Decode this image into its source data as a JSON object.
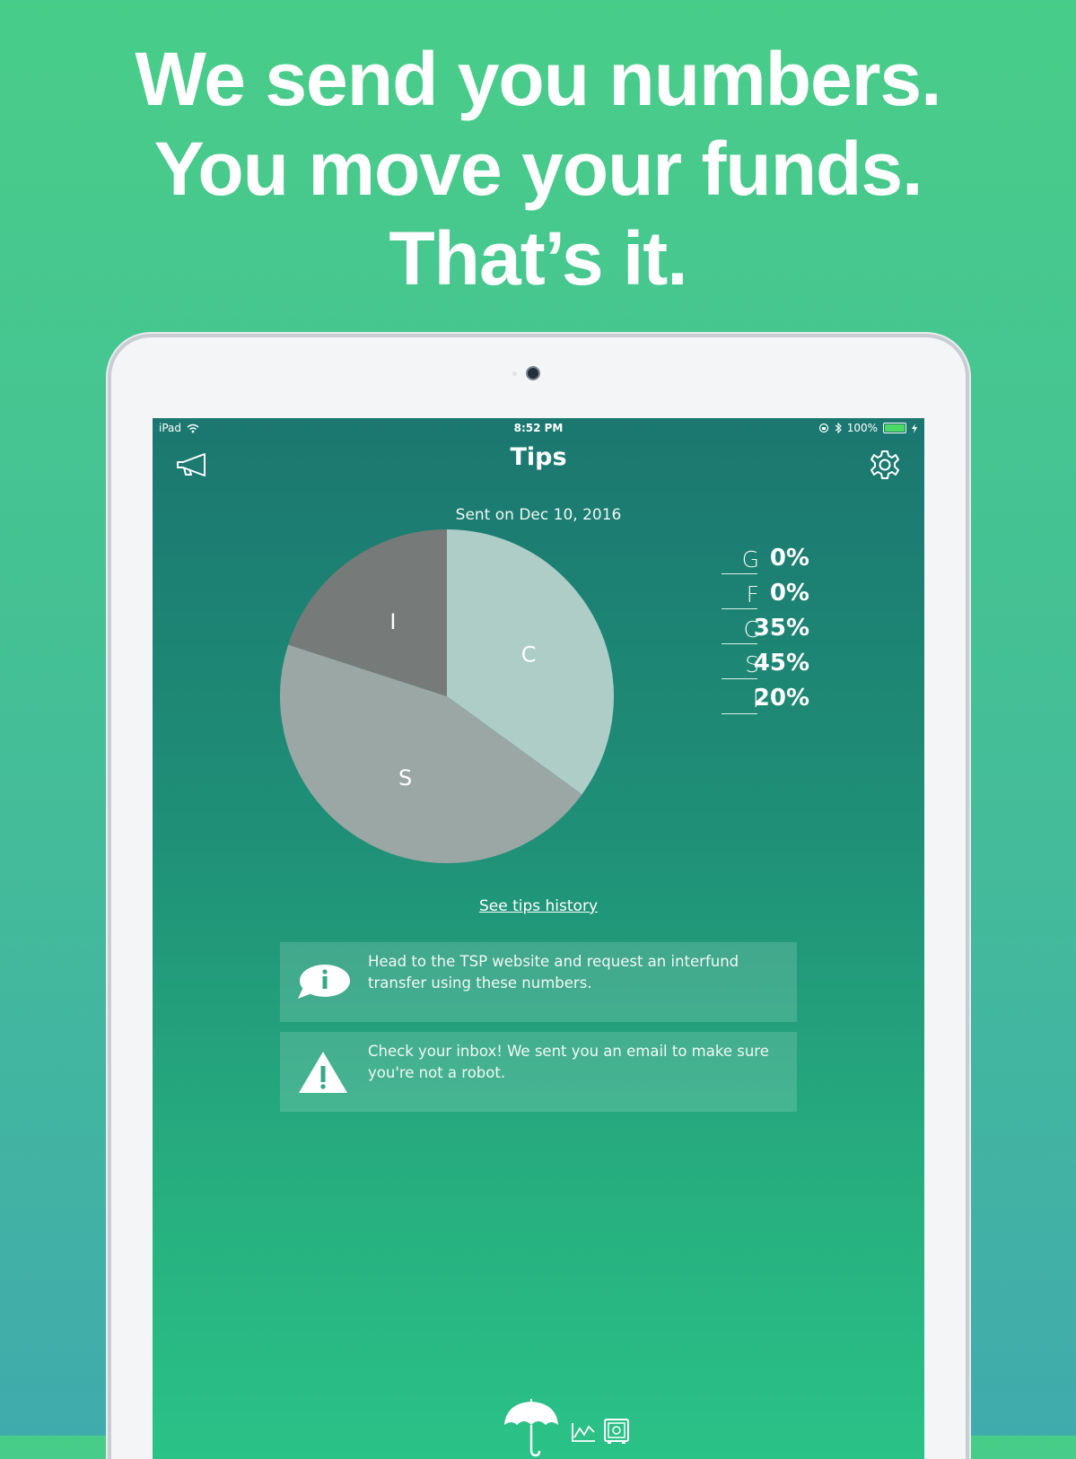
{
  "headline": {
    "line1": "We send you numbers.",
    "line2": "You move your funds.",
    "line3": "That’s it."
  },
  "status_bar": {
    "device": "iPad",
    "time": "8:52 PM",
    "battery": "100%"
  },
  "nav": {
    "title": "Tips"
  },
  "sent_on": "Sent on Dec 10, 2016",
  "chart_data": {
    "type": "pie",
    "categories": [
      "G",
      "F",
      "C",
      "S",
      "I"
    ],
    "values": [
      0,
      0,
      35,
      45,
      20
    ],
    "slice_labels": [
      "C",
      "S",
      "I"
    ],
    "colors": {
      "C": "#adcdc6",
      "S": "#9ba7a4",
      "I": "#767b79"
    }
  },
  "allocations": [
    {
      "fund": "G",
      "value": "0%"
    },
    {
      "fund": "F",
      "value": "0%"
    },
    {
      "fund": "C",
      "value": "35%"
    },
    {
      "fund": "S",
      "value": "45%"
    },
    {
      "fund": "I",
      "value": "20%"
    }
  ],
  "history_link": "See tips history",
  "cards": {
    "info": "Head to the TSP website and request an interfund transfer using these numbers.",
    "warning": "Check your inbox! We sent you an email to make sure you're not a robot."
  },
  "icons": {
    "megaphone": "megaphone-icon",
    "settings": "gear-icon",
    "info": "info-bubble-icon",
    "warning": "warning-icon",
    "tab_tips": "umbrella-icon",
    "tab_chart": "line-chart-icon",
    "tab_safe": "safe-icon"
  }
}
